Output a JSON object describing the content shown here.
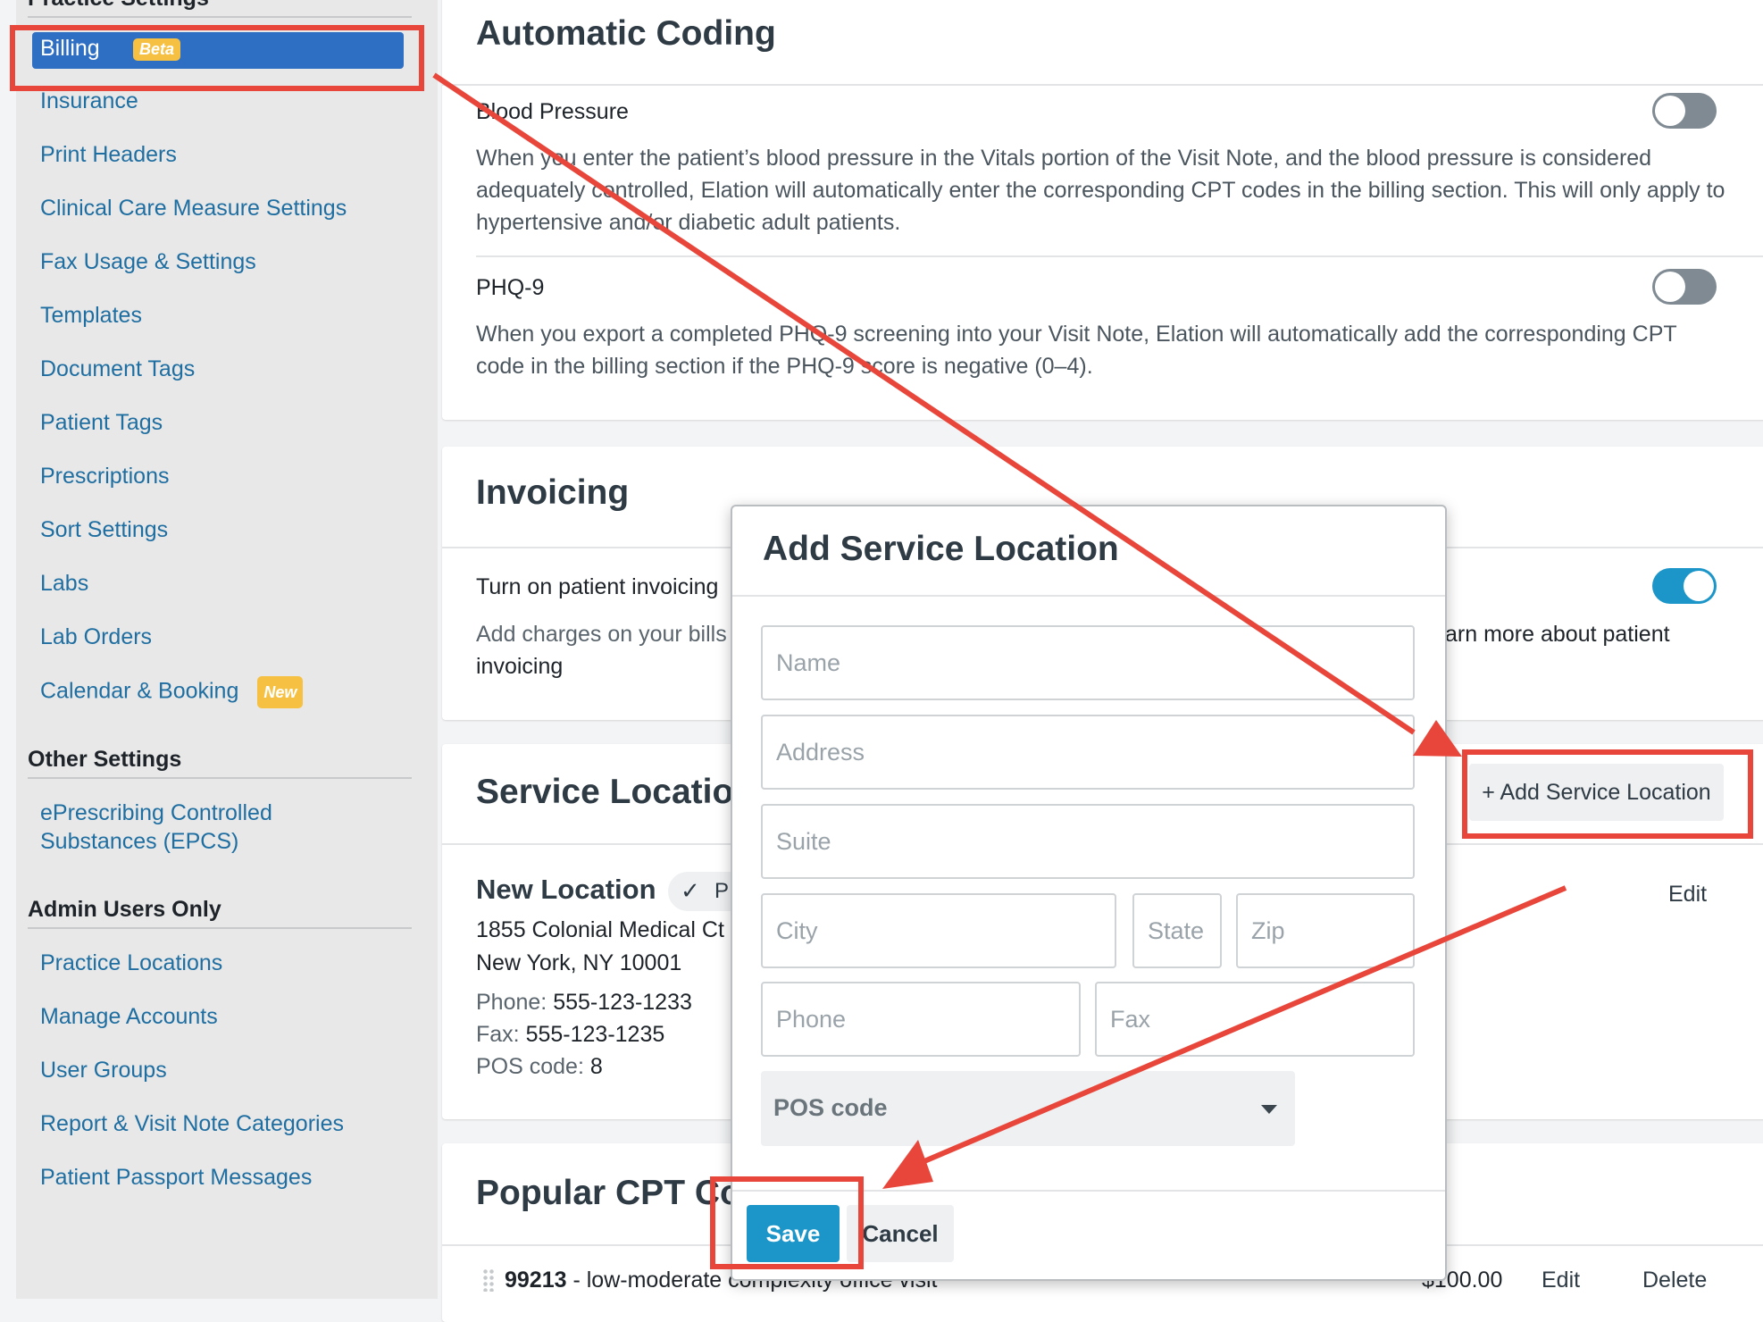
{
  "sidebar": {
    "heading_practice": "Practice Settings",
    "active": {
      "label": "Billing",
      "badge": "Beta"
    },
    "practice_items": [
      "Insurance",
      "Print Headers",
      "Clinical Care Measure Settings",
      "Fax Usage & Settings",
      "Templates",
      "Document Tags",
      "Patient Tags",
      "Prescriptions",
      "Sort Settings",
      "Labs",
      "Lab Orders",
      "Calendar & Booking"
    ],
    "calendar_badge": "New",
    "heading_other": "Other Settings",
    "other_items": [
      "ePrescribing Controlled",
      "Substances (EPCS)"
    ],
    "heading_admin": "Admin Users Only",
    "admin_items": [
      "Practice Locations",
      "Manage Accounts",
      "User Groups",
      "Report & Visit Note Categories",
      "Patient Passport Messages"
    ]
  },
  "automatic_coding": {
    "title": "Automatic Coding",
    "bp_title": "Blood Pressure",
    "bp_desc": "When you enter the patient’s blood pressure in the Vitals portion of the Visit Note, and the blood pressure is considered adequately controlled, Elation will automatically enter the corresponding CPT codes in the billing section. This will only apply to hypertensive and/or diabetic adult patients.",
    "phq_title": "PHQ-9",
    "phq_desc": "When you export a completed PHQ-9 screening into your Visit Note, Elation will automatically add the corresponding CPT code in the billing section if the PHQ-9 score is negative (0–4)."
  },
  "invoicing": {
    "title": "Invoicing",
    "row_title": "Turn on patient invoicing",
    "desc_start": "Add charges on your bills",
    "desc_link_tail": "arn more about patient",
    "desc_link_line2": "invoicing"
  },
  "service_locations": {
    "title": "Service Locatior",
    "add_button": "+ Add Service Location",
    "location_name": "New Location",
    "pill_text": "P",
    "address_line1": "1855 Colonial Medical Ct",
    "address_line2": "New York, NY 10001",
    "phone_label": "Phone:",
    "phone_value": "555-123-1233",
    "fax_label": "Fax:",
    "fax_value": "555-123-1235",
    "pos_label": "POS code:",
    "pos_value": "8",
    "edit": "Edit"
  },
  "popular_cpt": {
    "title": "Popular CPT Co",
    "row_code": "99213",
    "row_desc": " - low-moderate complexity office visit",
    "row_price": "$100.00",
    "row_edit": "Edit",
    "row_delete": "Delete"
  },
  "modal": {
    "title": "Add Service Location",
    "ph_name": "Name",
    "ph_address": "Address",
    "ph_suite": "Suite",
    "ph_city": "City",
    "ph_state": "State",
    "ph_zip": "Zip",
    "ph_phone": "Phone",
    "ph_fax": "Fax",
    "pos_select": "POS code",
    "save": "Save",
    "cancel": "Cancel"
  },
  "colors": {
    "annotation_red": "#e8463a",
    "accent_blue": "#1c95c8",
    "active_nav": "#2f6fc3",
    "badge": "#f6c143",
    "link": "#1f6ea1"
  }
}
